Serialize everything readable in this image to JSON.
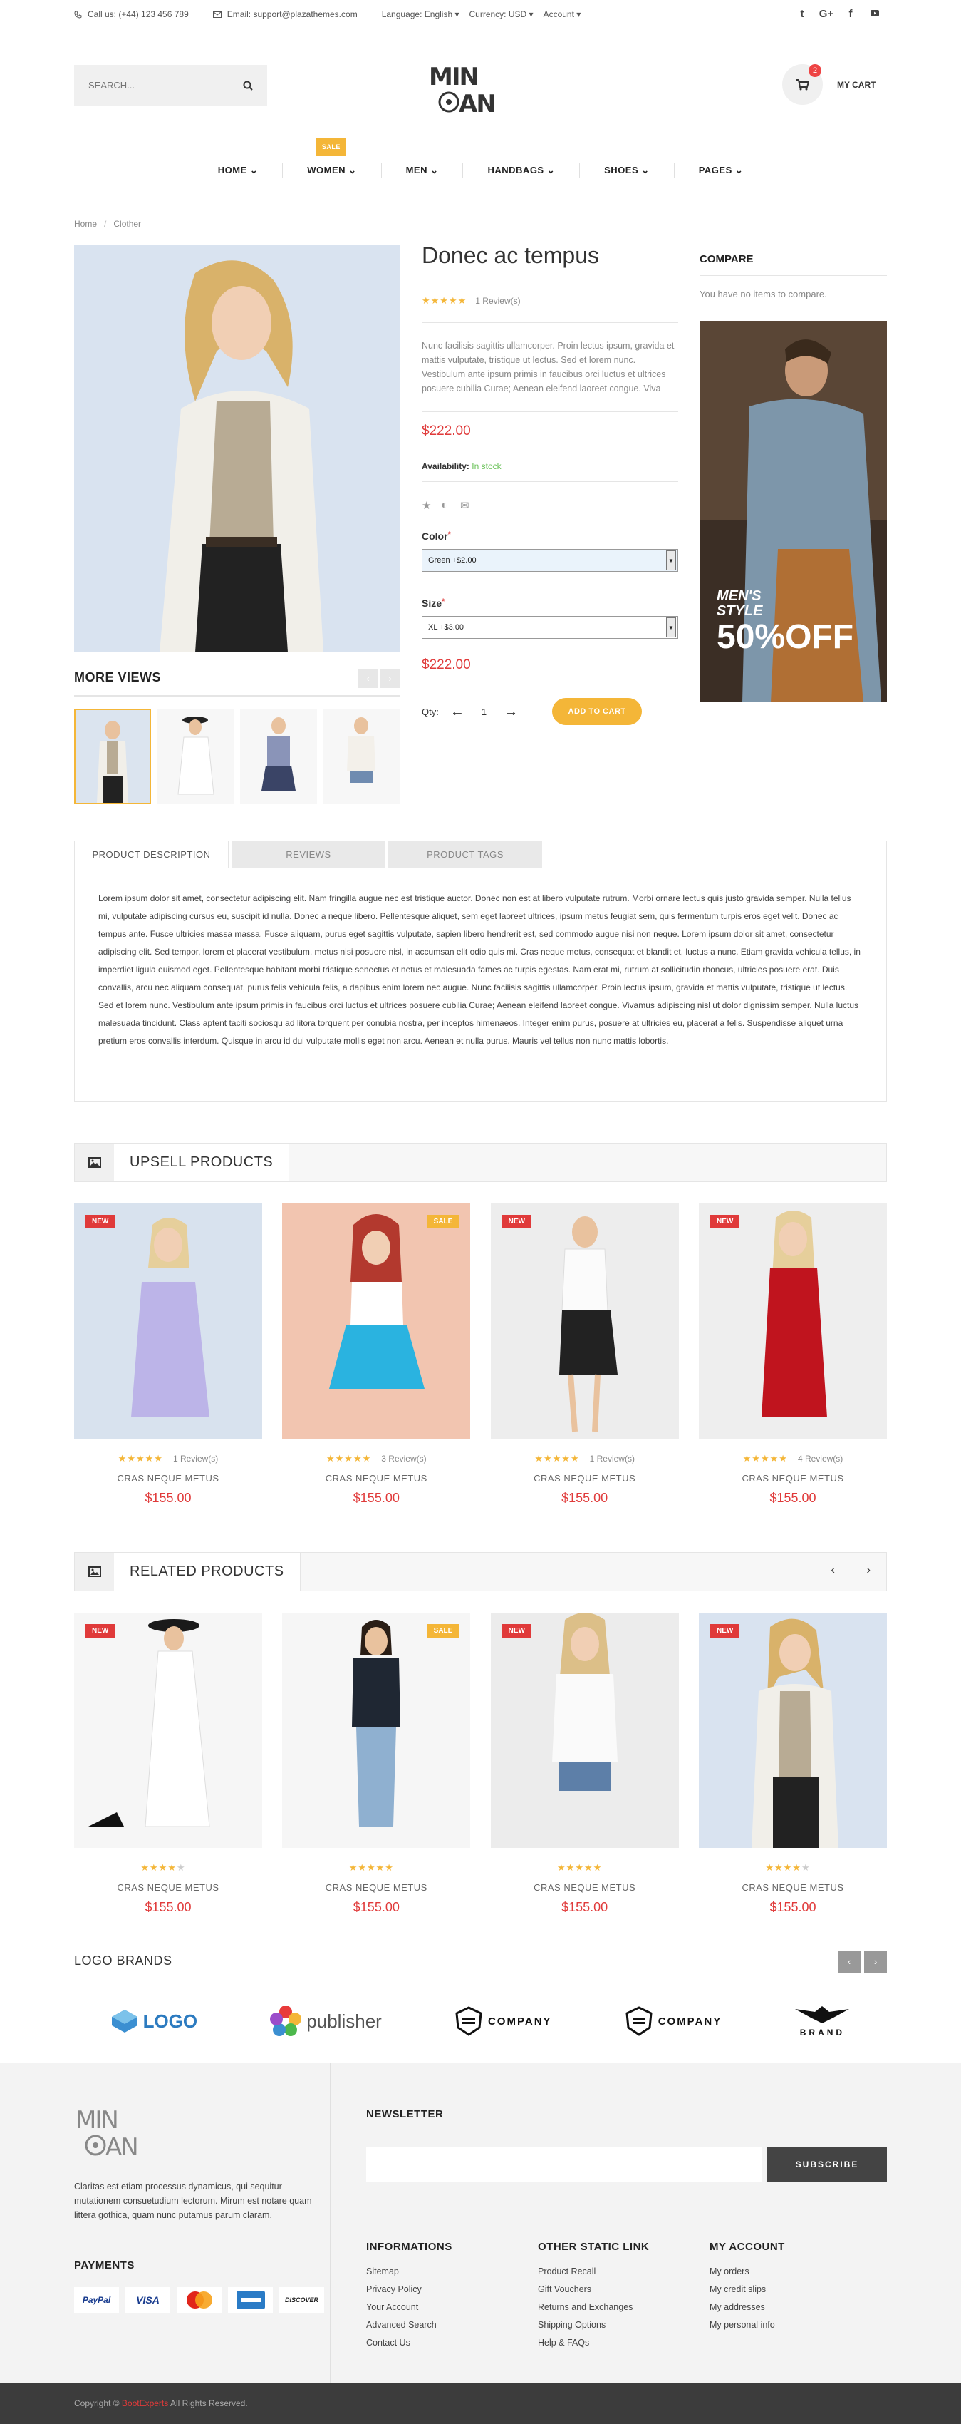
{
  "topbar": {
    "phone": "Call us: (+44) 123 456 789",
    "email": "Email: support@plazathemes.com",
    "language": "Language: English",
    "currency": "Currency: USD",
    "account": "Account",
    "social_icons": [
      "twitter-icon",
      "google-plus-icon",
      "facebook-icon",
      "youtube-icon"
    ]
  },
  "header": {
    "search_placeholder": "SEARCH...",
    "logo_line1": "MIN",
    "logo_line2": "OAN",
    "cart_count": "2",
    "cart_label": "MY CART"
  },
  "nav": {
    "items": [
      "HOME",
      "WOMEN",
      "MEN",
      "HANDBAGS",
      "SHOES",
      "PAGES"
    ],
    "sale_badge": "SALE"
  },
  "breadcrumb": {
    "home": "Home",
    "current": "Clother"
  },
  "product": {
    "title": "Donec ac tempus",
    "rating": 5,
    "reviews": "1 Review(s)",
    "description": "Nunc facilisis sagittis ullamcorper. Proin lectus ipsum, gravida et mattis vulputate, tristique ut lectus. Sed et lorem nunc. Vestibulum ante ipsum primis in faucibus orci luctus et ultrices posuere cubilia Curae; Aenean eleifend laoreet congue. Viva",
    "price": "$222.00",
    "availability_label": "Availability:",
    "availability_value": "In stock",
    "color_label": "Color",
    "color_value": "Green +$2.00",
    "size_label": "Size",
    "size_value": "XL +$3.00",
    "price_total": "$222.00",
    "qty_label": "Qty:",
    "qty_value": "1",
    "add_to_cart": "ADD TO CART",
    "more_views": "MORE VIEWS"
  },
  "compare": {
    "title": "COMPARE",
    "empty": "You have no items to compare.",
    "banner_line1": "MEN'S",
    "banner_line2": "STYLE",
    "banner_offer": "50%OFF"
  },
  "tabs": {
    "labels": [
      "PRODUCT DESCRIPTION",
      "REVIEWS",
      "PRODUCT TAGS"
    ],
    "body": "Lorem ipsum dolor sit amet, consectetur adipiscing elit. Nam fringilla augue nec est tristique auctor. Donec non est at libero vulputate rutrum. Morbi ornare lectus quis justo gravida semper. Nulla tellus mi, vulputate adipiscing cursus eu, suscipit id nulla. Donec a neque libero. Pellentesque aliquet, sem eget laoreet ultrices, ipsum metus feugiat sem, quis fermentum turpis eros eget velit. Donec ac tempus ante. Fusce ultricies massa massa. Fusce aliquam, purus eget sagittis vulputate, sapien libero hendrerit est, sed commodo augue nisi non neque. Lorem ipsum dolor sit amet, consectetur adipiscing elit. Sed tempor, lorem et placerat vestibulum, metus nisi posuere nisl, in accumsan elit odio quis mi. Cras neque metus, consequat et blandit et, luctus a nunc. Etiam gravida vehicula tellus, in imperdiet ligula euismod eget. Pellentesque habitant morbi tristique senectus et netus et malesuada fames ac turpis egestas. Nam erat mi, rutrum at sollicitudin rhoncus, ultricies posuere erat. Duis convallis, arcu nec aliquam consequat, purus felis vehicula felis, a dapibus enim lorem nec augue. Nunc facilisis sagittis ullamcorper. Proin lectus ipsum, gravida et mattis vulputate, tristique ut lectus. Sed et lorem nunc. Vestibulum ante ipsum primis in faucibus orci luctus et ultrices posuere cubilia Curae; Aenean eleifend laoreet congue. Vivamus adipiscing nisl ut dolor dignissim semper. Nulla luctus malesuada tincidunt. Class aptent taciti sociosqu ad litora torquent per conubia nostra, per inceptos himenaeos. Integer enim purus, posuere at ultricies eu, placerat a felis. Suspendisse aliquet urna pretium eros convallis interdum. Quisque in arcu id dui vulputate mollis eget non arcu. Aenean et nulla purus. Mauris vel tellus non nunc mattis lobortis."
  },
  "upsell": {
    "title": "UPSELL PRODUCTS",
    "items": [
      {
        "badge": "NEW",
        "rating": 5,
        "reviews": "1 Review(s)",
        "name": "CRAS NEQUE METUS",
        "price": "$155.00"
      },
      {
        "badge": "SALE",
        "rating": 5,
        "reviews": "3 Review(s)",
        "name": "CRAS NEQUE METUS",
        "price": "$155.00"
      },
      {
        "badge": "NEW",
        "rating": 5,
        "reviews": "1 Review(s)",
        "name": "CRAS NEQUE METUS",
        "price": "$155.00"
      },
      {
        "badge": "NEW",
        "rating": 5,
        "reviews": "4 Review(s)",
        "name": "CRAS NEQUE METUS",
        "price": "$155.00"
      }
    ]
  },
  "related": {
    "title": "RELATED PRODUCTS",
    "items": [
      {
        "badge": "NEW",
        "rating": 4,
        "name": "CRAS NEQUE METUS",
        "price": "$155.00"
      },
      {
        "badge": "SALE",
        "rating": 5,
        "name": "CRAS NEQUE METUS",
        "price": "$155.00"
      },
      {
        "badge": "NEW",
        "rating": 5,
        "name": "CRAS NEQUE METUS",
        "price": "$155.00"
      },
      {
        "badge": "NEW",
        "rating": 4,
        "name": "CRAS NEQUE METUS",
        "price": "$155.00"
      }
    ]
  },
  "brands": {
    "title": "LOGO BRANDS",
    "items": [
      "LOGO",
      "publisher",
      "COMPANY",
      "COMPANY",
      "BRAND"
    ]
  },
  "footer": {
    "about": "Claritas est etiam processus dynamicus, qui sequitur mutationem consuetudium lectorum. Mirum est notare quam littera gothica, quam nunc putamus parum claram.",
    "payments_title": "PAYMENTS",
    "payment_cards": [
      "PayPal",
      "VISA",
      "MasterCard",
      "Amex",
      "DISCOVER"
    ],
    "newsletter_title": "NEWSLETTER",
    "subscribe": "SUBSCRIBE",
    "col1_title": "INFORMATIONS",
    "col1": [
      "Sitemap",
      "Privacy Policy",
      "Your Account",
      "Advanced Search",
      "Contact Us"
    ],
    "col2_title": "OTHER STATIC LINK",
    "col2": [
      "Product Recall",
      "Gift Vouchers",
      "Returns and Exchanges",
      "Shipping Options",
      "Help & FAQs"
    ],
    "col3_title": "MY ACCOUNT",
    "col3": [
      "My orders",
      "My credit slips",
      "My addresses",
      "My personal info"
    ],
    "copyright_pre": "Copyright ©",
    "copyright_brand": "BootExperts",
    "copyright_post": "All Rights Reserved."
  },
  "colors": {
    "accent": "#f4b638",
    "price": "#e03a3a",
    "new_badge": "#e03a3a"
  }
}
